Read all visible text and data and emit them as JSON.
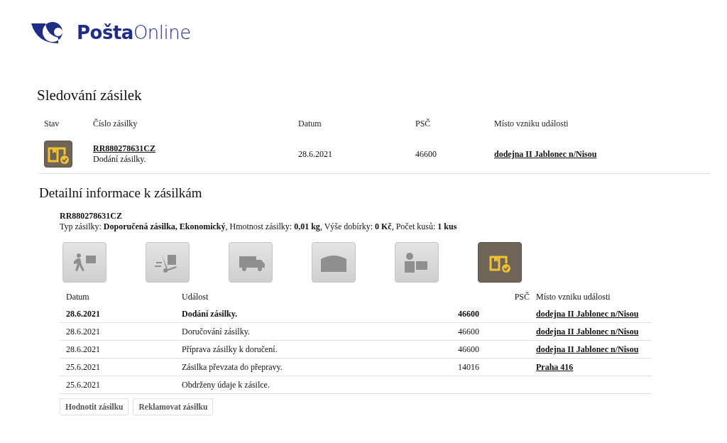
{
  "logo": {
    "bold": "Pošta",
    "light": "Online"
  },
  "tracking": {
    "title": "Sledování zásilek",
    "columns": [
      "Stav",
      "Číslo zásilky",
      "Datum",
      "PSČ",
      "Místo vzniku události"
    ],
    "rows": [
      {
        "number": "RR880278631CZ",
        "status": "Dodání zásilky.",
        "date": "28.6.2021",
        "psc": "46600",
        "place": "dodejna II Jablonec n/Nisou"
      }
    ]
  },
  "detail": {
    "title": "Detailní informace k zásilkám",
    "number": "RR880278631CZ",
    "info": "Typ zásilky: **Doporučená zásilka, Ekonomický**, Hmotnost zásilky: **0,01 kg**, Výše dobírky: **0 Kč**, Počet kusů: **1 kus**",
    "stages": [
      {
        "active": false
      },
      {
        "active": false
      },
      {
        "active": false
      },
      {
        "active": false
      },
      {
        "active": false
      },
      {
        "active": true
      }
    ],
    "columns": [
      "Datum",
      "Událost",
      "PSČ",
      "Místo vzniku události"
    ],
    "events": [
      {
        "date": "28.6.2021",
        "event": "Dodání zásilky.",
        "psc": "46600",
        "place": "dodejna II Jablonec n/Nisou",
        "current": true
      },
      {
        "date": "28.6.2021",
        "event": "Doručování zásilky.",
        "psc": "46600",
        "place": "dodejna II Jablonec n/Nisou",
        "current": false
      },
      {
        "date": "28.6.2021",
        "event": "Příprava zásilky k doručení.",
        "psc": "46600",
        "place": "dodejna II Jablonec n/Nisou",
        "current": false
      },
      {
        "date": "25.6.2021",
        "event": "Zásilka převzata do přepravy.",
        "psc": "14016",
        "place": "Praha 416",
        "current": false
      },
      {
        "date": "25.6.2021",
        "event": "Obdrženy údaje k zásilce.",
        "current": false
      }
    ],
    "buttons": [
      "Hodnotit zásilku",
      "Reklamovat zásilku"
    ]
  }
}
